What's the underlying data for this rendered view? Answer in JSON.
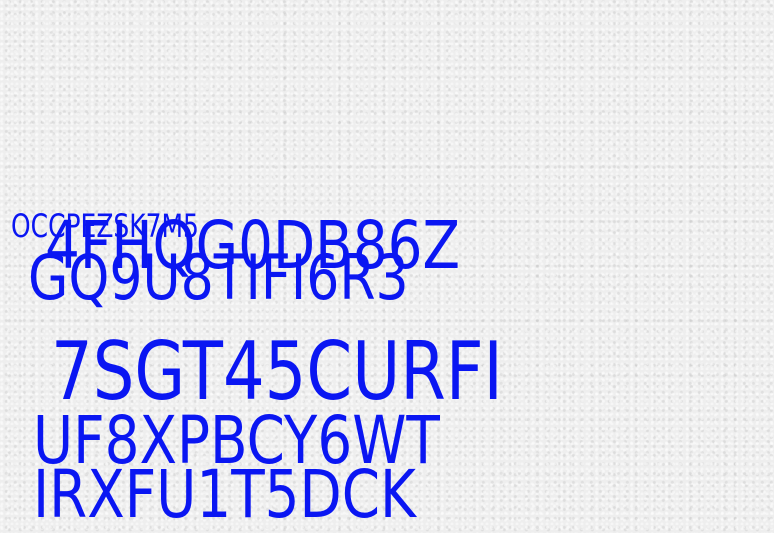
{
  "text_color": "#0a16f2",
  "background_color": "#eeeeee",
  "background_texture": "textured-white-paper",
  "codes": [
    "OCCPEZSK7M5",
    "4FHQG0DB86Z",
    "GQ9U8TIFI6R3",
    "7SGT45CURFI",
    "UF8XPBCY6WT",
    "IRXFU1T5DCK"
  ]
}
